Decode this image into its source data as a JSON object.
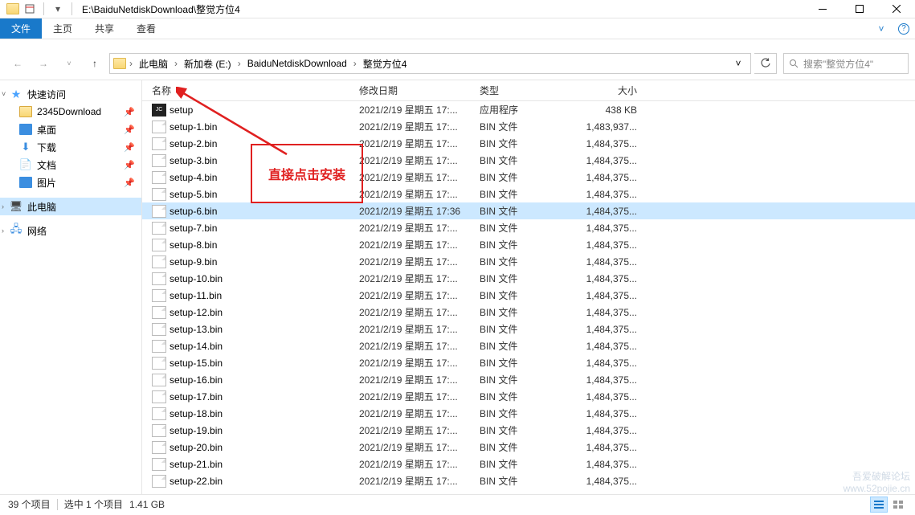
{
  "window": {
    "title": "E:\\BaiduNetdiskDownload\\整觉方位4"
  },
  "ribbon": {
    "file": "文件",
    "home": "主页",
    "share": "共享",
    "view": "查看"
  },
  "breadcrumbs": [
    "此电脑",
    "新加卷 (E:)",
    "BaiduNetdiskDownload",
    "整觉方位4"
  ],
  "search": {
    "placeholder": "搜索\"整觉方位4\""
  },
  "sidebar": {
    "quick_access": "快速访问",
    "items": [
      {
        "label": "2345Download",
        "icon": "folder",
        "pinned": true
      },
      {
        "label": "桌面",
        "icon": "desktop",
        "pinned": true
      },
      {
        "label": "下载",
        "icon": "download",
        "pinned": true
      },
      {
        "label": "文档",
        "icon": "doc",
        "pinned": true
      },
      {
        "label": "图片",
        "icon": "pic",
        "pinned": true
      }
    ],
    "this_pc": "此电脑",
    "network": "网络"
  },
  "columns": {
    "name": "名称",
    "date_modified": "修改日期",
    "type": "类型",
    "size": "大小"
  },
  "files": [
    {
      "name": "setup",
      "date": "2021/2/19 星期五 17:...",
      "type": "应用程序",
      "size": "438 KB",
      "icon": "app"
    },
    {
      "name": "setup-1.bin",
      "date": "2021/2/19 星期五 17:...",
      "type": "BIN 文件",
      "size": "1,483,937...",
      "icon": "bin"
    },
    {
      "name": "setup-2.bin",
      "date": "2021/2/19 星期五 17:...",
      "type": "BIN 文件",
      "size": "1,484,375...",
      "icon": "bin"
    },
    {
      "name": "setup-3.bin",
      "date": "2021/2/19 星期五 17:...",
      "type": "BIN 文件",
      "size": "1,484,375...",
      "icon": "bin"
    },
    {
      "name": "setup-4.bin",
      "date": "2021/2/19 星期五 17:...",
      "type": "BIN 文件",
      "size": "1,484,375...",
      "icon": "bin"
    },
    {
      "name": "setup-5.bin",
      "date": "2021/2/19 星期五 17:...",
      "type": "BIN 文件",
      "size": "1,484,375...",
      "icon": "bin"
    },
    {
      "name": "setup-6.bin",
      "date": "2021/2/19 星期五 17:36",
      "type": "BIN 文件",
      "size": "1,484,375...",
      "icon": "bin",
      "selected": true
    },
    {
      "name": "setup-7.bin",
      "date": "2021/2/19 星期五 17:...",
      "type": "BIN 文件",
      "size": "1,484,375...",
      "icon": "bin"
    },
    {
      "name": "setup-8.bin",
      "date": "2021/2/19 星期五 17:...",
      "type": "BIN 文件",
      "size": "1,484,375...",
      "icon": "bin"
    },
    {
      "name": "setup-9.bin",
      "date": "2021/2/19 星期五 17:...",
      "type": "BIN 文件",
      "size": "1,484,375...",
      "icon": "bin"
    },
    {
      "name": "setup-10.bin",
      "date": "2021/2/19 星期五 17:...",
      "type": "BIN 文件",
      "size": "1,484,375...",
      "icon": "bin"
    },
    {
      "name": "setup-11.bin",
      "date": "2021/2/19 星期五 17:...",
      "type": "BIN 文件",
      "size": "1,484,375...",
      "icon": "bin"
    },
    {
      "name": "setup-12.bin",
      "date": "2021/2/19 星期五 17:...",
      "type": "BIN 文件",
      "size": "1,484,375...",
      "icon": "bin"
    },
    {
      "name": "setup-13.bin",
      "date": "2021/2/19 星期五 17:...",
      "type": "BIN 文件",
      "size": "1,484,375...",
      "icon": "bin"
    },
    {
      "name": "setup-14.bin",
      "date": "2021/2/19 星期五 17:...",
      "type": "BIN 文件",
      "size": "1,484,375...",
      "icon": "bin"
    },
    {
      "name": "setup-15.bin",
      "date": "2021/2/19 星期五 17:...",
      "type": "BIN 文件",
      "size": "1,484,375...",
      "icon": "bin"
    },
    {
      "name": "setup-16.bin",
      "date": "2021/2/19 星期五 17:...",
      "type": "BIN 文件",
      "size": "1,484,375...",
      "icon": "bin"
    },
    {
      "name": "setup-17.bin",
      "date": "2021/2/19 星期五 17:...",
      "type": "BIN 文件",
      "size": "1,484,375...",
      "icon": "bin"
    },
    {
      "name": "setup-18.bin",
      "date": "2021/2/19 星期五 17:...",
      "type": "BIN 文件",
      "size": "1,484,375...",
      "icon": "bin"
    },
    {
      "name": "setup-19.bin",
      "date": "2021/2/19 星期五 17:...",
      "type": "BIN 文件",
      "size": "1,484,375...",
      "icon": "bin"
    },
    {
      "name": "setup-20.bin",
      "date": "2021/2/19 星期五 17:...",
      "type": "BIN 文件",
      "size": "1,484,375...",
      "icon": "bin"
    },
    {
      "name": "setup-21.bin",
      "date": "2021/2/19 星期五 17:...",
      "type": "BIN 文件",
      "size": "1,484,375...",
      "icon": "bin"
    },
    {
      "name": "setup-22.bin",
      "date": "2021/2/19 星期五 17:...",
      "type": "BIN 文件",
      "size": "1,484,375...",
      "icon": "bin"
    }
  ],
  "status": {
    "count": "39 个项目",
    "selected": "选中 1 个项目",
    "size": "1.41 GB"
  },
  "annotation": {
    "text": "直接点击安装"
  },
  "watermark": {
    "line1": "吾爱破解论坛",
    "line2": "www.52pojie.cn"
  }
}
